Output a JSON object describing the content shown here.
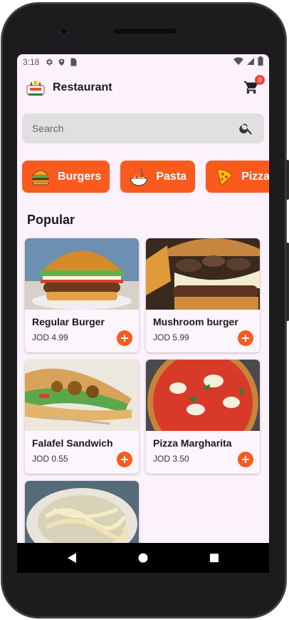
{
  "status_bar": {
    "time": "3:18"
  },
  "app_bar": {
    "title": "Restaurant",
    "cart_count": "0"
  },
  "search": {
    "placeholder": "Search"
  },
  "categories": [
    {
      "label": "Burgers",
      "icon": "burger-icon"
    },
    {
      "label": "Pasta",
      "icon": "pasta-icon"
    },
    {
      "label": "Pizza",
      "icon": "pizza-icon"
    }
  ],
  "section": {
    "title": "Popular"
  },
  "products": [
    {
      "name": "Regular Burger",
      "price": "JOD 4.99"
    },
    {
      "name": "Mushroom burger",
      "price": "JOD 5.99"
    },
    {
      "name": "Falafel Sandwich",
      "price": "JOD 0.55"
    },
    {
      "name": "Pizza Margharita",
      "price": "JOD 3.50"
    },
    {
      "name": "",
      "price": ""
    }
  ],
  "colors": {
    "accent": "#fb5a1f",
    "background": "#fcf2fb",
    "search_bg": "#e0e0e0",
    "badge": "#f04438"
  }
}
